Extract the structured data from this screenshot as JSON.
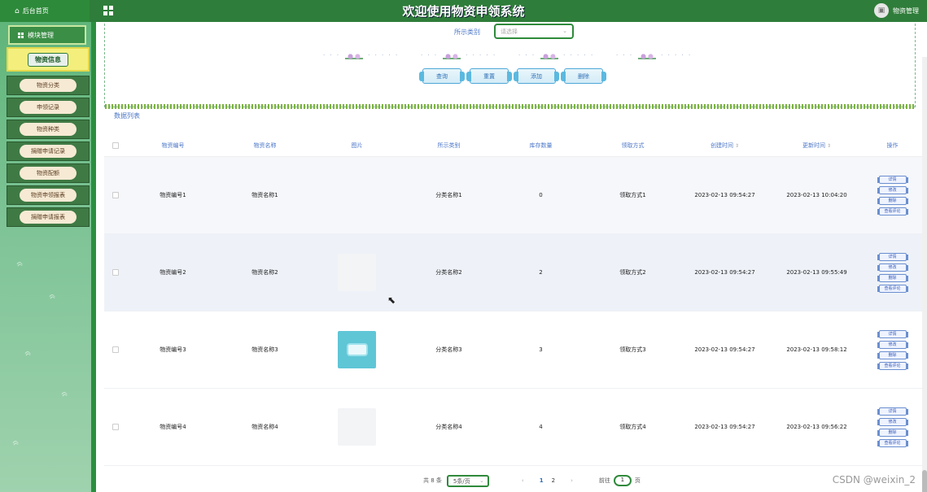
{
  "header": {
    "home_label": "后台首页",
    "title": "欢迎使用物资申领系统",
    "user_label": "物资管理"
  },
  "sidebar": {
    "section_label": "模块管理",
    "items": [
      {
        "label": "物资信息",
        "active": true
      },
      {
        "label": "物资分类"
      },
      {
        "label": "申领记录"
      },
      {
        "label": "物资种类"
      },
      {
        "label": "捐赠申请记录"
      },
      {
        "label": "物资配额"
      },
      {
        "label": "物资申领报表"
      },
      {
        "label": "捐赠申请报表"
      }
    ]
  },
  "search": {
    "category_label": "所示类别",
    "category_placeholder": "请选择",
    "buttons": [
      "查询",
      "重置",
      "添加",
      "删除"
    ]
  },
  "list_title": "数据列表",
  "table": {
    "headers": [
      "物资编号",
      "物资名称",
      "图片",
      "所示类别",
      "库存数量",
      "领取方式",
      "创建时间",
      "更新时间",
      "操作"
    ],
    "rows": [
      {
        "code": "物资编号1",
        "name": "物资名称1",
        "category": "分类名称1",
        "stock": "0",
        "method": "领取方式1",
        "created": "2023-02-13 09:54:27",
        "updated": "2023-02-13 10:04:20",
        "image": "none"
      },
      {
        "code": "物资编号2",
        "name": "物资名称2",
        "category": "分类名称2",
        "stock": "2",
        "method": "领取方式2",
        "created": "2023-02-13 09:54:27",
        "updated": "2023-02-13 09:55:49",
        "image": "blank"
      },
      {
        "code": "物资编号3",
        "name": "物资名称3",
        "category": "分类名称3",
        "stock": "3",
        "method": "领取方式3",
        "created": "2023-02-13 09:54:27",
        "updated": "2023-02-13 09:58:12",
        "image": "mask"
      },
      {
        "code": "物资编号4",
        "name": "物资名称4",
        "category": "分类名称4",
        "stock": "4",
        "method": "领取方式4",
        "created": "2023-02-13 09:54:27",
        "updated": "2023-02-13 09:56:22",
        "image": "blank"
      }
    ],
    "row_actions": [
      "详情",
      "修改",
      "删除",
      "查看评论"
    ]
  },
  "pager": {
    "total_text": "共 8 条",
    "page_size": "5条/页",
    "pages": [
      "1",
      "2"
    ],
    "goto_label": "前往",
    "goto_value": "1",
    "page_unit": "页"
  },
  "watermark": "CSDN @weixin_2"
}
